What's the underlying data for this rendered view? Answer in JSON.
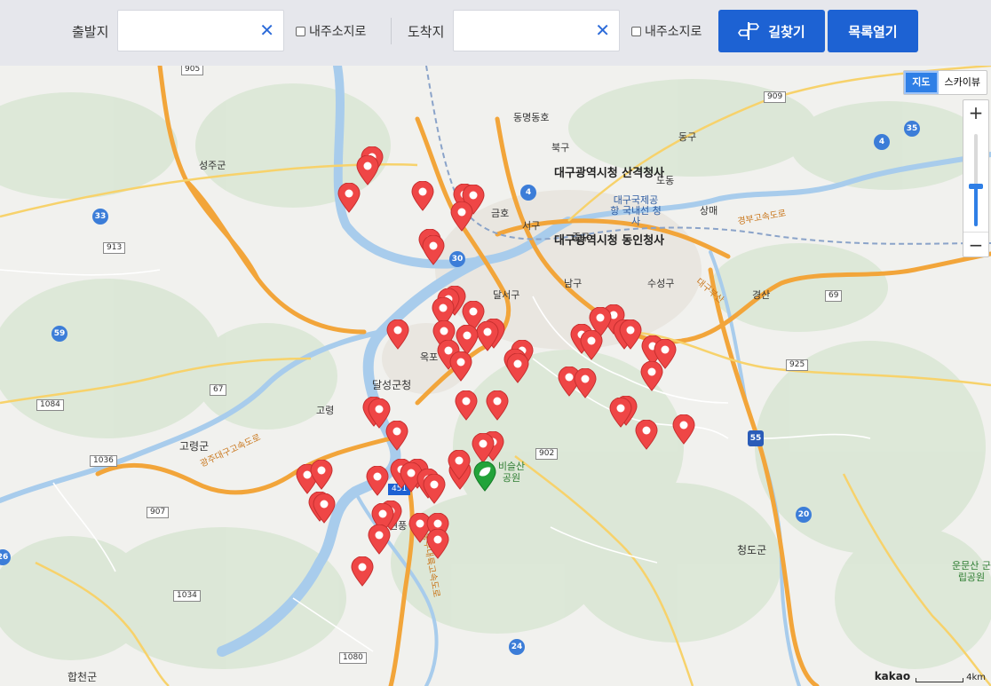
{
  "search": {
    "origin_label": "출발지",
    "origin_value": "",
    "dest_label": "도착지",
    "dest_value": "",
    "my_location_label": "내주소지로",
    "find_route_label": "길찾기",
    "open_list_label": "목록열기"
  },
  "map_controls": {
    "map_label": "지도",
    "skyview_label": "스카이뷰",
    "zoom_in": "+",
    "zoom_out": "−",
    "zoom_level_fraction": 0.42
  },
  "copyright": {
    "logo": "kakao",
    "scale": "4km"
  },
  "places": [
    {
      "id": "seongju",
      "text": "성주군"
    },
    {
      "id": "dongmyeong",
      "text": "동명동호"
    },
    {
      "id": "buk",
      "text": "북구"
    },
    {
      "id": "dong",
      "text": "동구"
    },
    {
      "id": "dongdo",
      "text": "도동"
    },
    {
      "id": "sanggyeok",
      "text": "대구광역시청 산격청사"
    },
    {
      "id": "airport",
      "text": "대구국제공항 국내선 청사"
    },
    {
      "id": "geumho",
      "text": "금호"
    },
    {
      "id": "seo",
      "text": "서구"
    },
    {
      "id": "dongin",
      "text": "대구광역시청 동인청사"
    },
    {
      "id": "junggu",
      "text": "중구"
    },
    {
      "id": "sangmae",
      "text": "상매"
    },
    {
      "id": "dalseo",
      "text": "달서구"
    },
    {
      "id": "nam",
      "text": "남구"
    },
    {
      "id": "suseong",
      "text": "수성구"
    },
    {
      "id": "gyeongsan",
      "text": "경산"
    },
    {
      "id": "okpo",
      "text": "옥포"
    },
    {
      "id": "dalseong",
      "text": "달성군청"
    },
    {
      "id": "goryeong_town",
      "text": "고령"
    },
    {
      "id": "goryeong",
      "text": "고령군"
    },
    {
      "id": "biseul",
      "text": "비슬산 공원"
    },
    {
      "id": "cheongdo",
      "text": "청도군"
    },
    {
      "id": "unmun",
      "text": "운문산 군립공원"
    },
    {
      "id": "hapcheon",
      "text": "합천군"
    },
    {
      "id": "hyeonpung",
      "text": "현풍"
    },
    {
      "id": "gyeongbu",
      "text": "경부고속도로"
    },
    {
      "id": "daegu_bu",
      "text": "대구부산"
    },
    {
      "id": "jungbu",
      "text": "중부내륙고속도로"
    },
    {
      "id": "gwangju_daegu",
      "text": "광주대구고속도로"
    }
  ],
  "routes": [
    "905",
    "909",
    "35",
    "4",
    "33",
    "913",
    "30",
    "69",
    "59",
    "925",
    "67",
    "1084",
    "902",
    "1036",
    "907",
    "55",
    "20",
    "26",
    "1034",
    "1080",
    "24",
    "451"
  ],
  "markers": [
    {
      "type": "red",
      "lat_idx": 1
    },
    {
      "type": "red",
      "lat_idx": 2
    },
    {
      "type": "red",
      "lat_idx": 3
    },
    {
      "type": "green",
      "lat_idx": 0
    }
  ],
  "colors": {
    "marker_red": "#ef4646",
    "marker_green": "#22a33a",
    "primary_button": "#1d62d3",
    "water": "#a8ccec",
    "highway": "#f2a53a"
  }
}
